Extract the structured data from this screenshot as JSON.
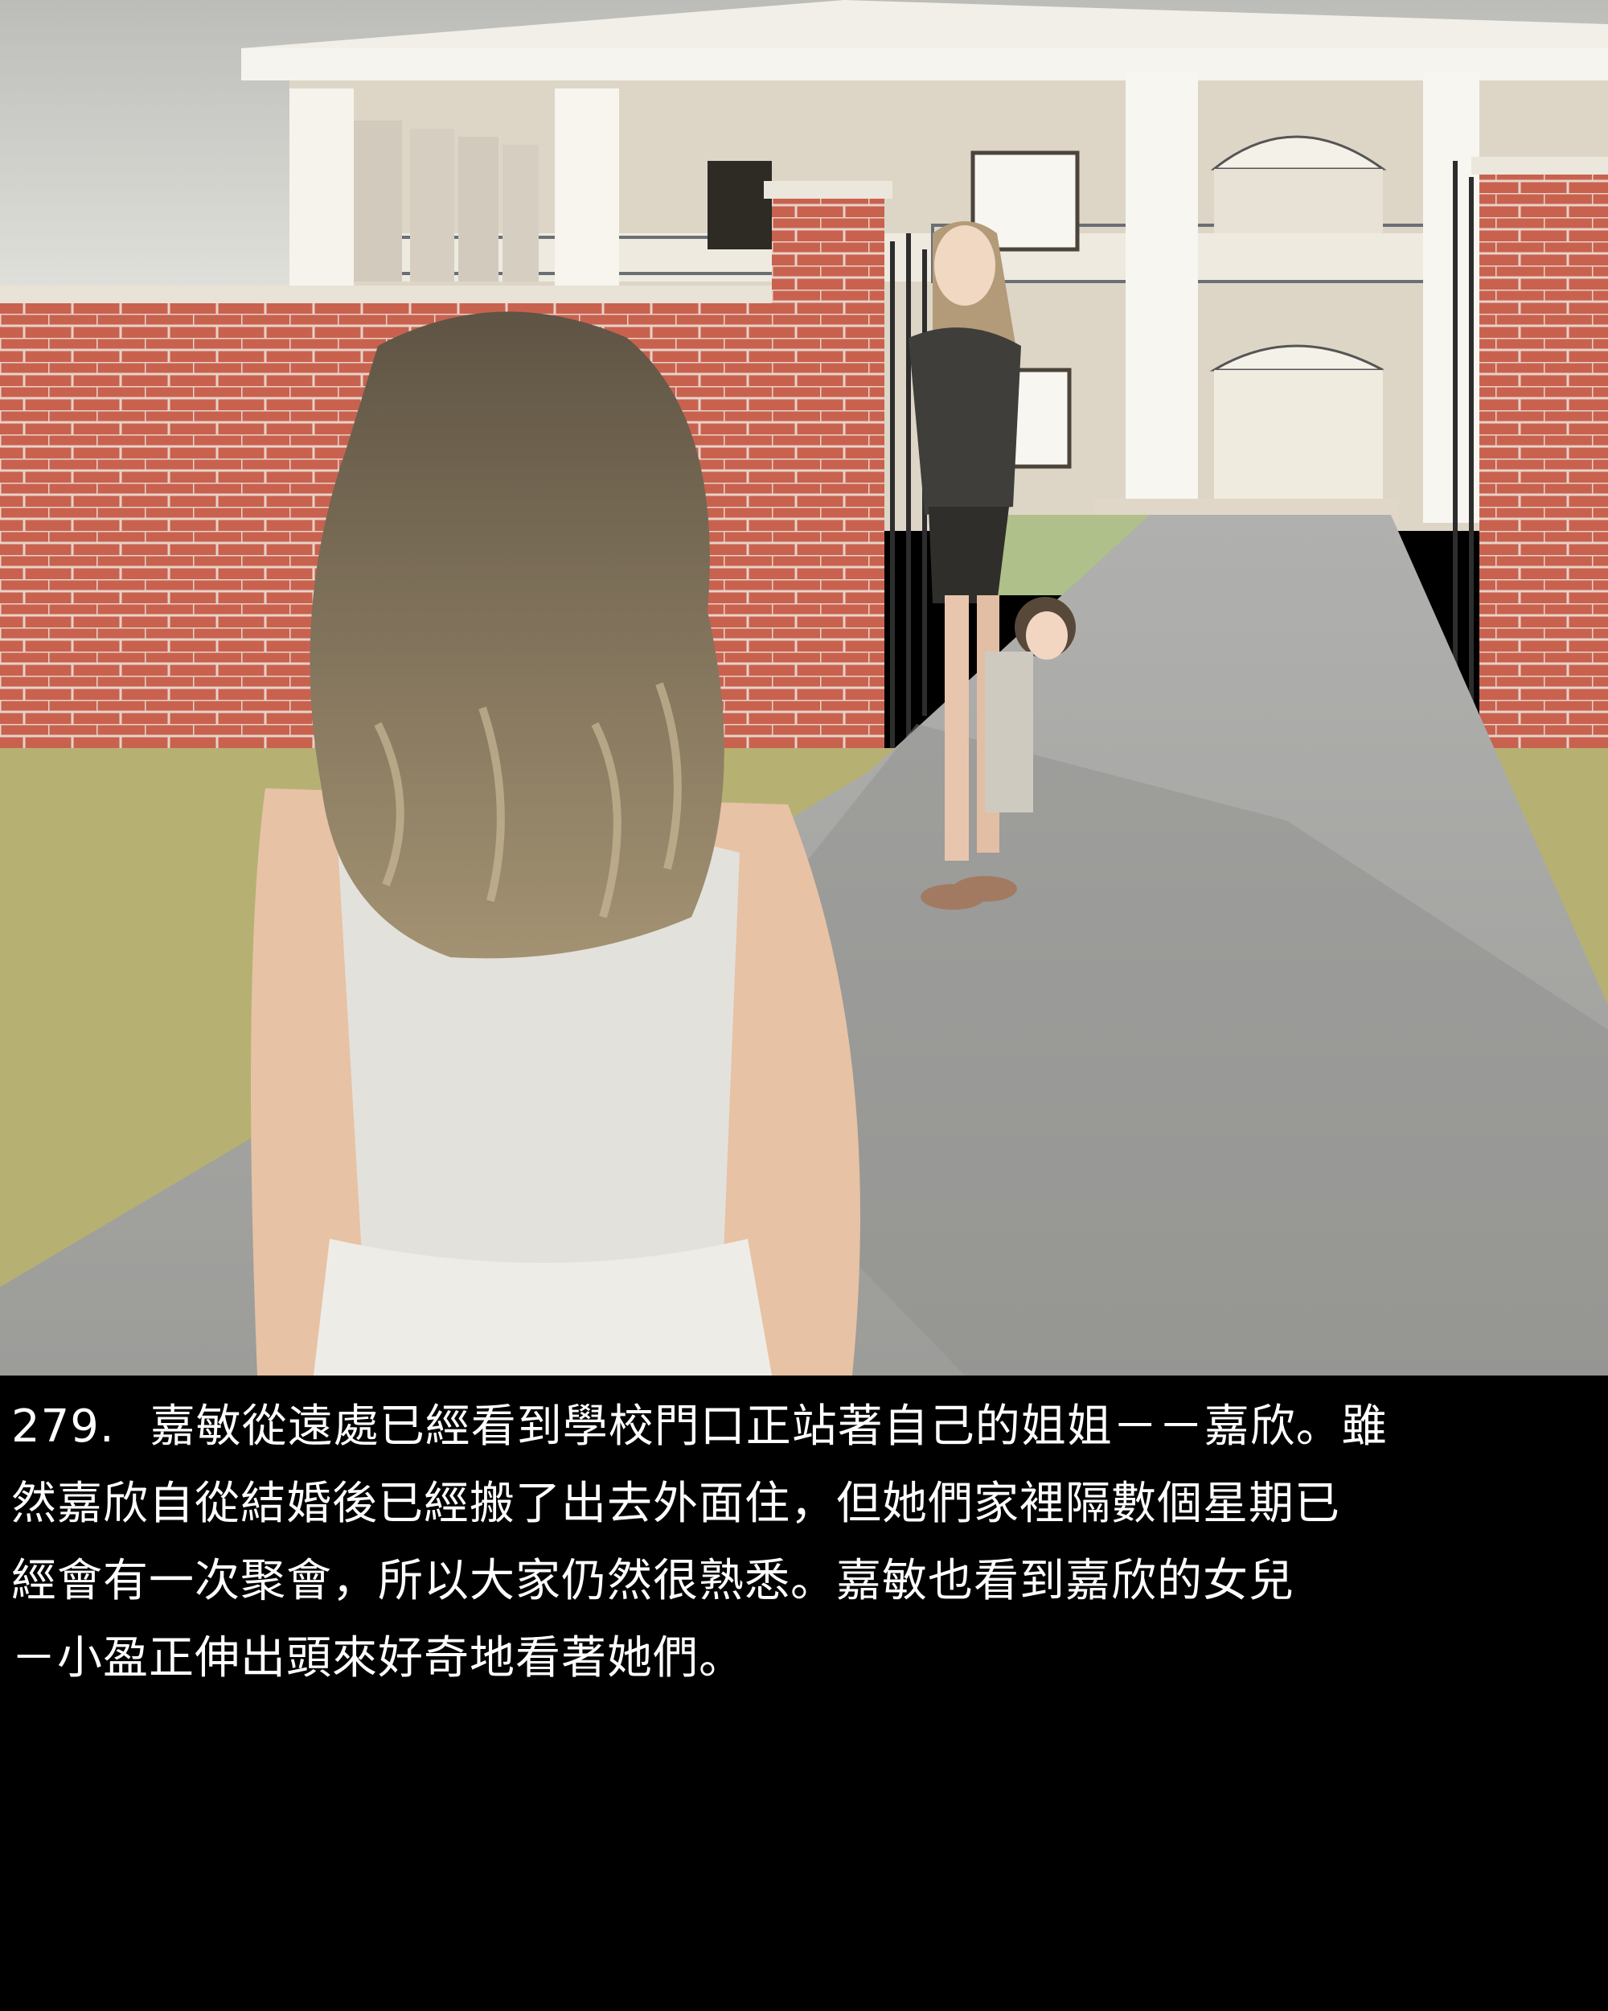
{
  "scene": {
    "description_icon": "illustration-image",
    "colors": {
      "sky": "#cfcfc9",
      "brick": "#c7604e",
      "mortar": "#e6d0c6",
      "house": "#ded7c9",
      "pillar": "#f4f2ea",
      "path": "#a6a6a2",
      "grass": "#b8b472",
      "hair": "#8a7a62",
      "dress": "#e2e0da",
      "suit": "#3e3e3a"
    }
  },
  "caption": {
    "number": "279.",
    "line1": "嘉敏從遠處已經看到學校門口正站著自己的姐姐－－嘉欣。雖",
    "line2": "然嘉欣自從結婚後已經搬了出去外面住，但她們家裡隔數個星期已",
    "line3": "經會有一次聚會，所以大家仍然很熟悉。嘉敏也看到嘉欣的女兒",
    "line4": "－小盈正伸出頭來好奇地看著她們。"
  }
}
